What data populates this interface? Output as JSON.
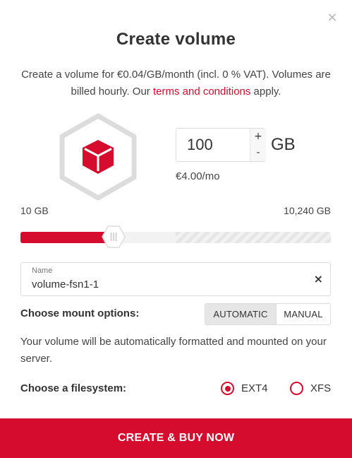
{
  "dialog": {
    "close_symbol": "×",
    "title": "Create volume",
    "description_before": "Create a volume for €0.04/GB/month (incl. 0 % VAT). Volumes are billed hourly. Our ",
    "description_link": "terms and conditions",
    "description_after": " apply."
  },
  "volume_icon": {
    "icon": "cube-icon",
    "hex_color": "#dcdcdc",
    "cube_color": "#d50c2d"
  },
  "size": {
    "value": "100",
    "unit": "GB",
    "increment_label": "+",
    "decrement_label": "-",
    "price": "€4.00/mo"
  },
  "slider": {
    "min_label": "10 GB",
    "max_label": "10,240 GB",
    "value_fraction": 0.3,
    "available_fraction": 0.5
  },
  "name_field": {
    "label": "Name",
    "value": "volume-fsn1-1",
    "clear_symbol": "×"
  },
  "mount": {
    "label": "Choose mount options:",
    "options": [
      {
        "label": "AUTOMATIC",
        "selected": true
      },
      {
        "label": "MANUAL",
        "selected": false
      }
    ],
    "description": "Your volume will be automatically formatted and mounted on your server."
  },
  "filesystem": {
    "label": "Choose a filesystem:",
    "options": [
      {
        "label": "EXT4",
        "selected": true
      },
      {
        "label": "XFS",
        "selected": false
      }
    ]
  },
  "submit_label": "CREATE & BUY NOW",
  "colors": {
    "accent": "#d50c2d",
    "border": "#dcdcdc",
    "text": "#333333"
  }
}
